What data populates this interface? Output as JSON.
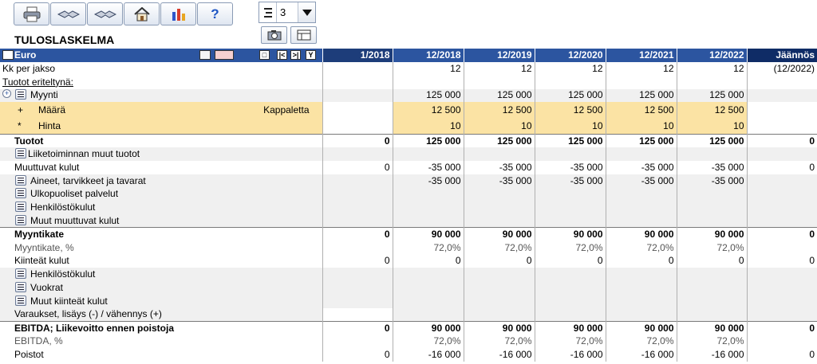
{
  "toolbar": {
    "icons": [
      "printer-icon",
      "handshake-left-icon",
      "handshake-right-icon",
      "home-icon",
      "bar-chart-icon",
      "help-icon"
    ],
    "help_label": "?",
    "level_value": "3"
  },
  "title": "TULOSLASKELMA",
  "header": {
    "currency": "Euro",
    "periods": [
      "1/2018",
      "12/2018",
      "12/2019",
      "12/2020",
      "12/2021",
      "12/2022"
    ],
    "remainder": "Jäännös"
  },
  "rows": {
    "kk": {
      "label": "Kk per jakso",
      "values": [
        "",
        "12",
        "12",
        "12",
        "12",
        "12"
      ],
      "remainder": "(12/2022)"
    },
    "tuotot_eritelty": {
      "label": "Tuotot eriteltynä:"
    },
    "myynti": {
      "label": "Myynti",
      "values": [
        "",
        "125 000",
        "125 000",
        "125 000",
        "125 000",
        "125 000"
      ]
    },
    "maara": {
      "marker": "+",
      "label": "Määrä",
      "unit": "Kappaletta",
      "values": [
        "",
        "12 500",
        "12 500",
        "12 500",
        "12 500",
        "12 500"
      ]
    },
    "hinta": {
      "marker": "*",
      "label": "Hinta",
      "values": [
        "",
        "10",
        "10",
        "10",
        "10",
        "10"
      ]
    },
    "tuotot": {
      "label": "Tuotot",
      "values": [
        "0",
        "125 000",
        "125 000",
        "125 000",
        "125 000",
        "125 000"
      ],
      "remainder": "0"
    },
    "liiketoiminnan_muut": {
      "label": "Liiketoiminnan muut tuotot"
    },
    "muuttuvat_kulut": {
      "label": "Muuttuvat kulut",
      "values": [
        "0",
        "-35 000",
        "-35 000",
        "-35 000",
        "-35 000",
        "-35 000"
      ],
      "remainder": "0"
    },
    "aineet": {
      "label": "Aineet, tarvikkeet ja tavarat",
      "values": [
        "",
        "-35 000",
        "-35 000",
        "-35 000",
        "-35 000",
        "-35 000"
      ]
    },
    "ulkopuoliset": {
      "label": "Ulkopuoliset palvelut"
    },
    "henkilosto1": {
      "label": "Henkilöstökulut"
    },
    "muut_muuttuvat": {
      "label": "Muut muuttuvat kulut"
    },
    "myyntikate": {
      "label": "Myyntikate",
      "values": [
        "0",
        "90 000",
        "90 000",
        "90 000",
        "90 000",
        "90 000"
      ],
      "remainder": "0"
    },
    "myyntikate_pct": {
      "label": "Myyntikate, %",
      "values": [
        "",
        "72,0%",
        "72,0%",
        "72,0%",
        "72,0%",
        "72,0%"
      ]
    },
    "kiinteat": {
      "label": "Kiinteät kulut",
      "values": [
        "0",
        "0",
        "0",
        "0",
        "0",
        "0"
      ],
      "remainder": "0"
    },
    "henkilosto2": {
      "label": "Henkilöstökulut"
    },
    "vuokrat": {
      "label": "Vuokrat"
    },
    "muut_kiinteat": {
      "label": "Muut kiinteät kulut"
    },
    "varaukset": {
      "label": "Varaukset, lisäys (-) / vähennys (+)"
    },
    "ebitda": {
      "label": "EBITDA; Liikevoitto ennen poistoja",
      "values": [
        "0",
        "90 000",
        "90 000",
        "90 000",
        "90 000",
        "90 000"
      ],
      "remainder": "0"
    },
    "ebitda_pct": {
      "label": "EBITDA, %",
      "values": [
        "",
        "72,0%",
        "72,0%",
        "72,0%",
        "72,0%",
        "72,0%"
      ]
    },
    "poistot": {
      "label": "Poistot",
      "values": [
        "0",
        "-16 000",
        "-16 000",
        "-16 000",
        "-16 000",
        "-16 000"
      ],
      "remainder": "0"
    }
  }
}
